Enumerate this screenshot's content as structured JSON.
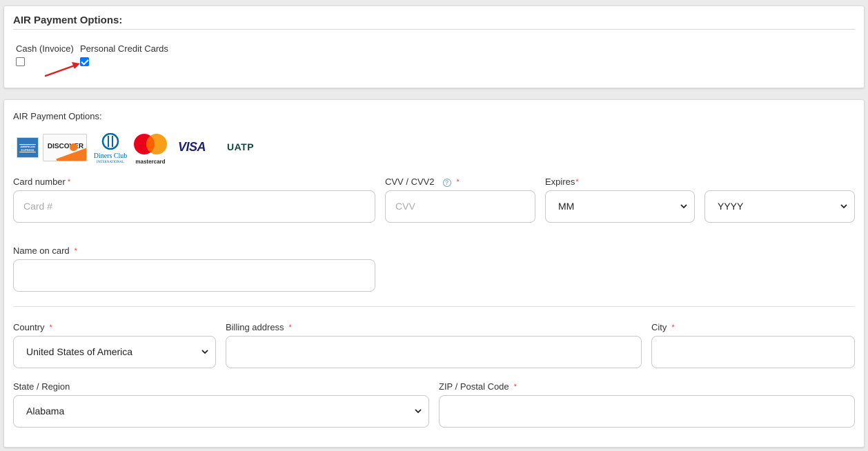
{
  "top_section": {
    "title": "AIR Payment Options:",
    "options": [
      {
        "label": "Cash (Invoice)",
        "checked": false
      },
      {
        "label": "Personal Credit Cards",
        "checked": true
      }
    ]
  },
  "card_section": {
    "title": "AIR Payment Options:",
    "card_logos": [
      "amex-logo",
      "discover-logo",
      "diners-club-logo",
      "mastercard-logo",
      "visa-logo",
      "uatp-logo"
    ],
    "logo_text": {
      "amex": "AMERICAN EXPRESS",
      "discover": "DISCOVER",
      "diners_line1": "Diners Club",
      "diners_line2": "INTERNATIONAL",
      "mastercard": "mastercard",
      "visa": "VISA",
      "uatp": "UATP"
    },
    "card_number": {
      "label": "Card number",
      "required": "*",
      "placeholder": "Card #"
    },
    "cvv": {
      "label": "CVV / CVV2",
      "help": "?",
      "required": "*",
      "placeholder": "CVV"
    },
    "expires": {
      "label": "Expires",
      "required": "*",
      "month_value": "MM",
      "year_value": "YYYY"
    },
    "name_on_card": {
      "label": "Name on card",
      "required": "*",
      "value": ""
    },
    "country": {
      "label": "Country",
      "required": "*",
      "value": "United States of America"
    },
    "billing_address": {
      "label": "Billing address",
      "required": "*",
      "value": ""
    },
    "city": {
      "label": "City",
      "required": "*",
      "value": ""
    },
    "state": {
      "label": "State / Region",
      "value": "Alabama"
    },
    "zip": {
      "label": "ZIP / Postal Code",
      "required": "*",
      "value": ""
    }
  },
  "colors": {
    "accent": "#0075ff",
    "required": "#e0453a",
    "arrow": "#e02020"
  }
}
